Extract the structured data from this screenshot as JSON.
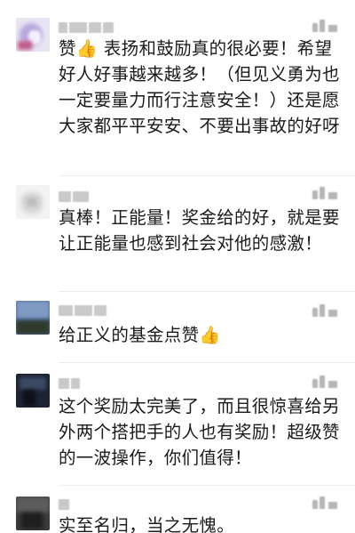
{
  "comments": [
    {
      "text": "赞👍 表扬和鼓励真的很必要！希望好人好事越来越多！（但见义勇为也一定要量力而行注意安全！）还是愿大家都平平安安、不要出事故的好呀",
      "avatar_icon": "user-avatar-icon",
      "like_icon": "like-icon"
    },
    {
      "text": "真棒！正能量！奖金给的好，就是要让正能量也感到社会对他的感激！",
      "avatar_icon": "user-avatar-icon",
      "like_icon": "like-icon"
    },
    {
      "text": "给正义的基金点赞👍",
      "avatar_icon": "user-avatar-icon",
      "like_icon": "like-icon"
    },
    {
      "text": "这个奖励太完美了，而且很惊喜给另外两个搭把手的人也有奖励！超级赞的一波操作，你们值得！",
      "avatar_icon": "user-avatar-icon",
      "like_icon": "like-icon"
    },
    {
      "text": "实至名归，当之无愧。",
      "avatar_icon": "user-avatar-icon",
      "like_icon": "like-icon"
    }
  ],
  "colors": {
    "text": "#1a1a1a",
    "meta": "#c9c9c9",
    "thumb": "#f5b93a"
  }
}
